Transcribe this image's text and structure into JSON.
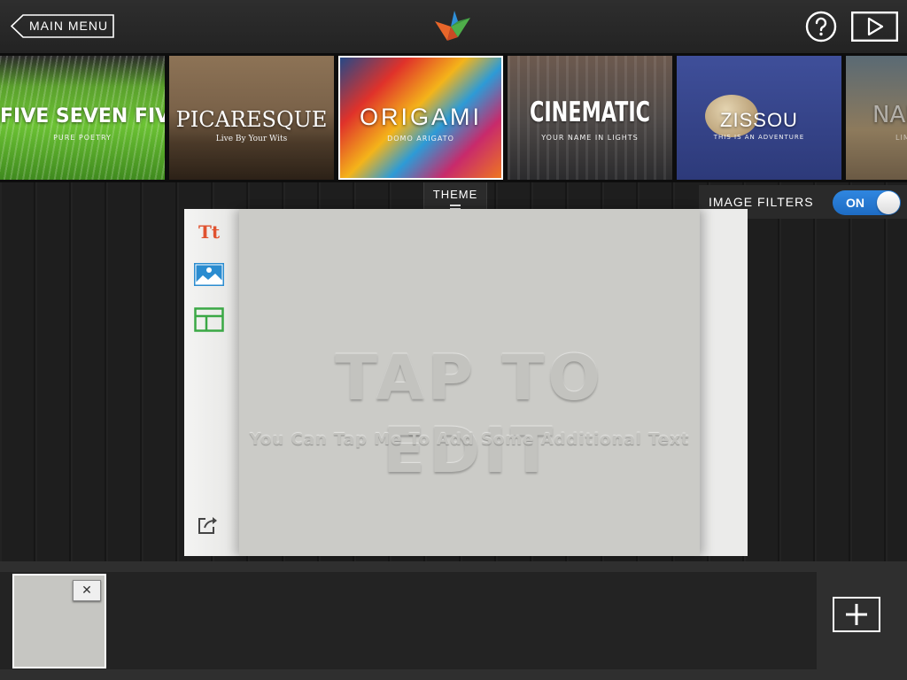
{
  "topbar": {
    "main_menu_label": "MAIN MENU",
    "logo_icon": "bird-logo-icon",
    "help_icon": "question-circle-icon",
    "play_icon": "play-icon"
  },
  "themes": [
    {
      "title": "FIVE SEVEN FIVE",
      "subtitle": "PURE POETRY",
      "selected": false
    },
    {
      "title": "PICARESQUE",
      "subtitle": "Live By Your Wits",
      "selected": false
    },
    {
      "title": "ORIGAMI",
      "subtitle": "DOMO ARIGATO",
      "selected": true
    },
    {
      "title": "CINEMATIC",
      "subtitle": "YOUR NAME IN LIGHTS",
      "selected": false
    },
    {
      "title": "ZISSOU",
      "subtitle": "THIS IS AN ADVENTURE",
      "selected": false
    },
    {
      "title": "NAN",
      "subtitle": "LIM",
      "selected": false
    }
  ],
  "workspace": {
    "theme_tab_label": "THEME",
    "image_filters_label": "IMAGE FILTERS",
    "image_filters_state": "ON"
  },
  "page": {
    "text_tool_label": "Tt",
    "title": "TAP TO EDIT",
    "subtitle": "You Can Tap Me To Add Some Additional Text"
  },
  "bottombar": {
    "thumb_close_symbol": "✕"
  },
  "colors": {
    "accent_blue": "#2f86e0",
    "text_tool_orange": "#e0522f",
    "image_tool_blue": "#2b8cd0",
    "layout_tool_green": "#3aa845"
  }
}
